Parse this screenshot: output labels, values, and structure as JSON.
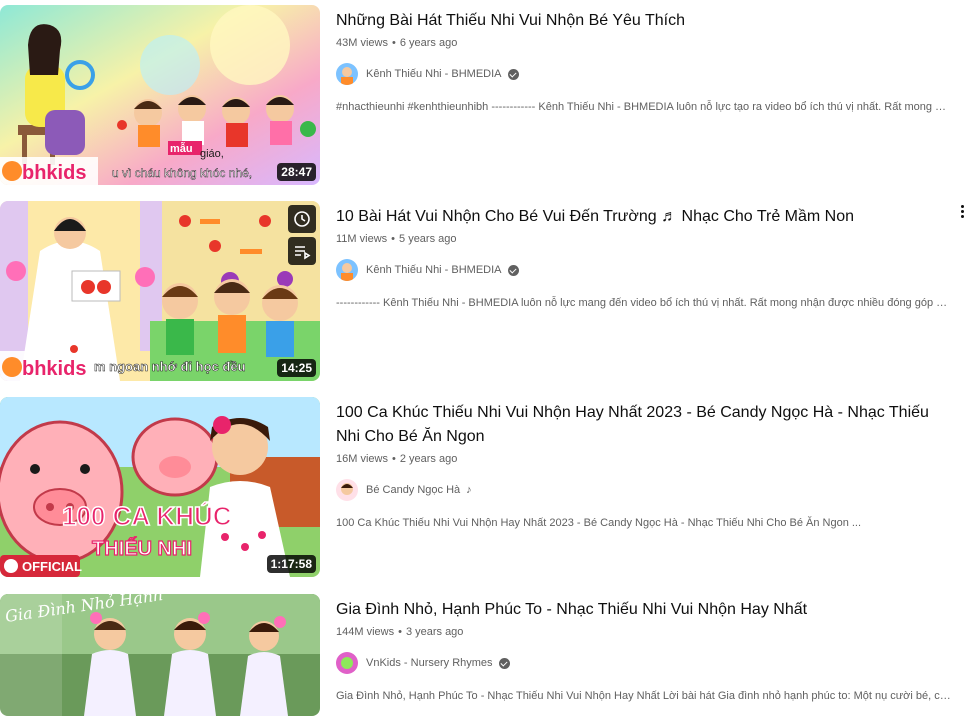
{
  "videos": [
    {
      "title": "Những Bài Hát Thiếu Nhi Vui Nhộn Bé Yêu Thích",
      "views": "43M views",
      "age": "6 years ago",
      "channel": "Kênh Thiếu Nhi - BHMEDIA",
      "verified": true,
      "description": "#nhacthieunhi #kenhthieunhibh ------------ Kênh Thiếu Nhi - BHMEDIA luôn nỗ lực tạo ra video bổ ích thú vị nhất. Rất mong nhận ...",
      "duration": "28:47",
      "thumb_text": "bhkids",
      "subtitle_a": "mẫu",
      "subtitle_b": "giáo,",
      "subtitle_c": "u vì cháu không khóc nhé,"
    },
    {
      "title": "10 Bài Hát Vui Nhộn Cho Bé Vui Đến Trường ♬ Nhạc Cho Trẻ Mầm Non",
      "views": "11M views",
      "age": "5 years ago",
      "channel": "Kênh Thiếu Nhi - BHMEDIA",
      "verified": true,
      "description": "------------ Kênh Thiếu Nhi - BHMEDIA luôn nỗ lực mang đến video bổ ích thú vị nhất. Rất mong nhận được nhiều đóng góp ý ...",
      "duration": "14:25",
      "thumb_text": "bhkids",
      "subtitle_a": "m ngoan nhớ đi học đều"
    },
    {
      "title": "100 Ca Khúc Thiếu Nhi Vui Nhộn Hay Nhất 2023 - Bé Candy Ngọc Hà - Nhạc Thiếu Nhi Cho Bé Ăn Ngon",
      "views": "16M views",
      "age": "2 years ago",
      "channel": "Bé Candy Ngọc Hà",
      "verified": false,
      "music_note": "♪",
      "description": "100 Ca Khúc Thiếu Nhi Vui Nhộn Hay Nhất 2023 - Bé Candy Ngọc Hà - Nhạc Thiếu Nhi Cho Bé Ăn Ngon ...",
      "duration": "1:17:58",
      "thumb_text": "100 CA KHÚC",
      "thumb_text2": "THIẾU NHI",
      "thumb_badge": "OFFICIAL"
    },
    {
      "title": "Gia Đình Nhỏ, Hạnh Phúc To - Nhạc Thiếu Nhi Vui Nhộn Hay Nhất",
      "views": "144M views",
      "age": "3 years ago",
      "channel": "VnKids - Nursery Rhymes",
      "verified": true,
      "description": "Gia Đình Nhỏ, Hạnh Phúc To - Nhạc Thiếu Nhi Vui Nhộn Hay Nhất Lời bài hát Gia đình nhỏ hạnh phúc to: Một nụ cười bé, cha vui ...",
      "thumb_text": "Gia Đình Nhỏ Hạnh"
    }
  ],
  "separator": "•",
  "icons": {
    "verified": "verified-badge-icon",
    "menu": "more-vert-icon",
    "watch_later": "clock-icon",
    "queue": "add-to-queue-icon"
  },
  "colors": {
    "brand_pink": "#e8246b",
    "text_secondary": "#606060",
    "badge_red": "#d6283a"
  }
}
